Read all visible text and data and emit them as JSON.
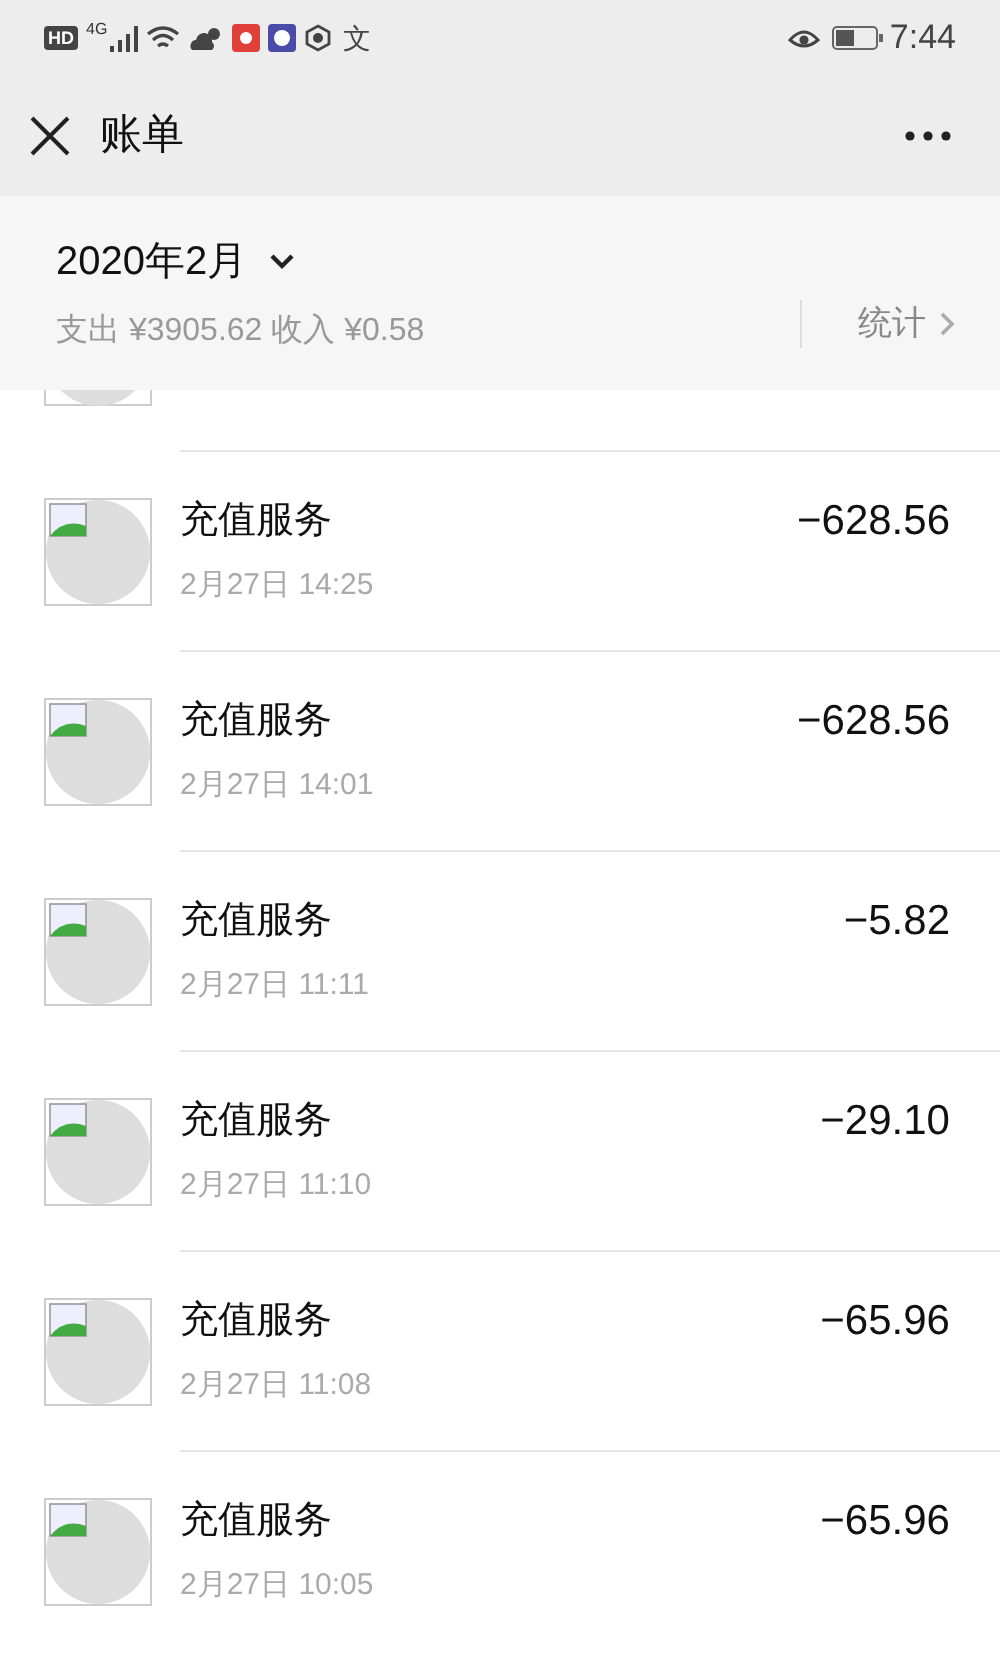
{
  "status_bar": {
    "time": "7:44",
    "hd": "HD",
    "network": "4G",
    "input_method": "文"
  },
  "nav": {
    "title": "账单"
  },
  "summary": {
    "month": "2020年2月",
    "totals": "支出 ¥3905.62 收入 ¥0.58",
    "stats_link": "统计"
  },
  "transactions": [
    {
      "title": "充值服务",
      "time": "2月27日 14:25",
      "amount": "−628.56"
    },
    {
      "title": "充值服务",
      "time": "2月27日 14:01",
      "amount": "−628.56"
    },
    {
      "title": "充值服务",
      "time": "2月27日 11:11",
      "amount": "−5.82"
    },
    {
      "title": "充值服务",
      "time": "2月27日 11:10",
      "amount": "−29.10"
    },
    {
      "title": "充值服务",
      "time": "2月27日 11:08",
      "amount": "−65.96"
    },
    {
      "title": "充值服务",
      "time": "2月27日 10:05",
      "amount": "−65.96"
    }
  ]
}
